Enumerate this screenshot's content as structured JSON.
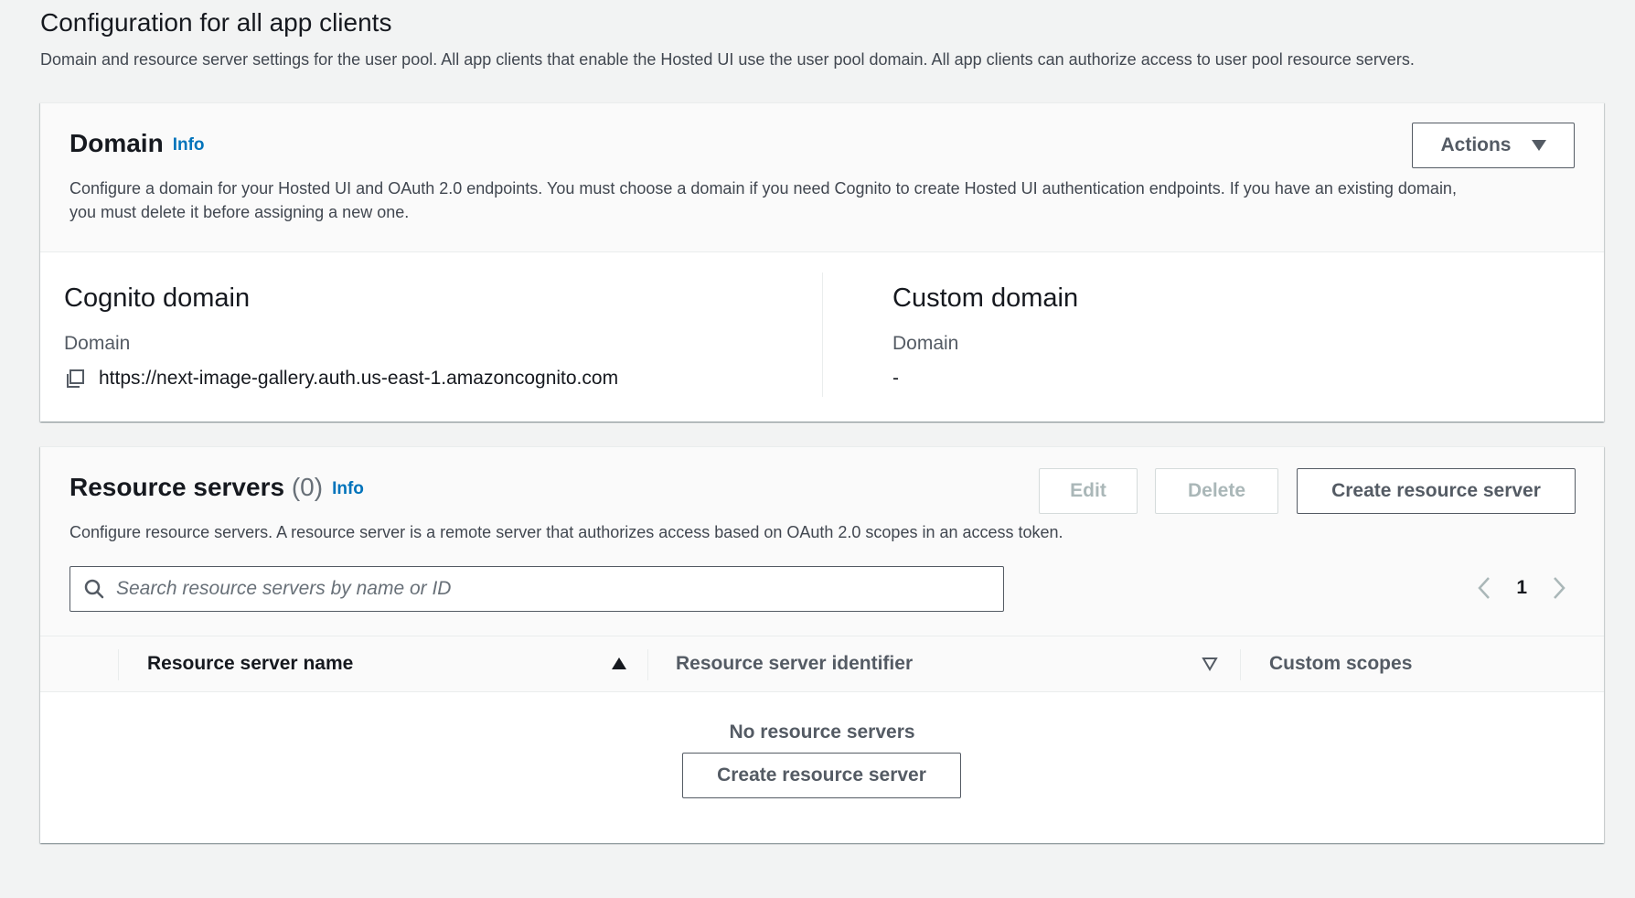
{
  "page": {
    "title": "Configuration for all app clients",
    "description": "Domain and resource server settings for the user pool. All app clients that enable the Hosted UI use the user pool domain. All app clients can authorize access to user pool resource servers."
  },
  "domain_section": {
    "title": "Domain",
    "info_label": "Info",
    "actions_label": "Actions",
    "description_line1": "Configure a domain for your Hosted UI and OAuth 2.0 endpoints. You must choose a domain if you need Cognito to create Hosted UI authentication endpoints. If you have an existing domain,",
    "description_line2": "you must delete it before assigning a new one.",
    "cognito": {
      "title": "Cognito domain",
      "label": "Domain",
      "value": "https://next-image-gallery.auth.us-east-1.amazoncognito.com"
    },
    "custom": {
      "title": "Custom domain",
      "label": "Domain",
      "value": "-"
    }
  },
  "resource_servers": {
    "title": "Resource servers",
    "count": "(0)",
    "info_label": "Info",
    "edit_label": "Edit",
    "delete_label": "Delete",
    "create_label": "Create resource server",
    "description": "Configure resource servers. A resource server is a remote server that authorizes access based on OAuth 2.0 scopes in an access token.",
    "search_placeholder": "Search resource servers by name or ID",
    "page_number": "1",
    "columns": [
      "Resource server name",
      "Resource server identifier",
      "Custom scopes"
    ],
    "empty_text": "No resource servers",
    "empty_create_label": "Create resource server"
  },
  "icons": {
    "copy": "copy-icon",
    "search": "search-icon",
    "caret": "caret-down-icon",
    "prev": "chevron-left-icon",
    "next": "chevron-right-icon",
    "sort_asc": "sort-ascending-icon",
    "sort_desc": "sort-descending-icon"
  },
  "colors": {
    "link": "#0073bb",
    "text": "#16191f",
    "muted": "#545b64",
    "background": "#f2f3f3"
  }
}
